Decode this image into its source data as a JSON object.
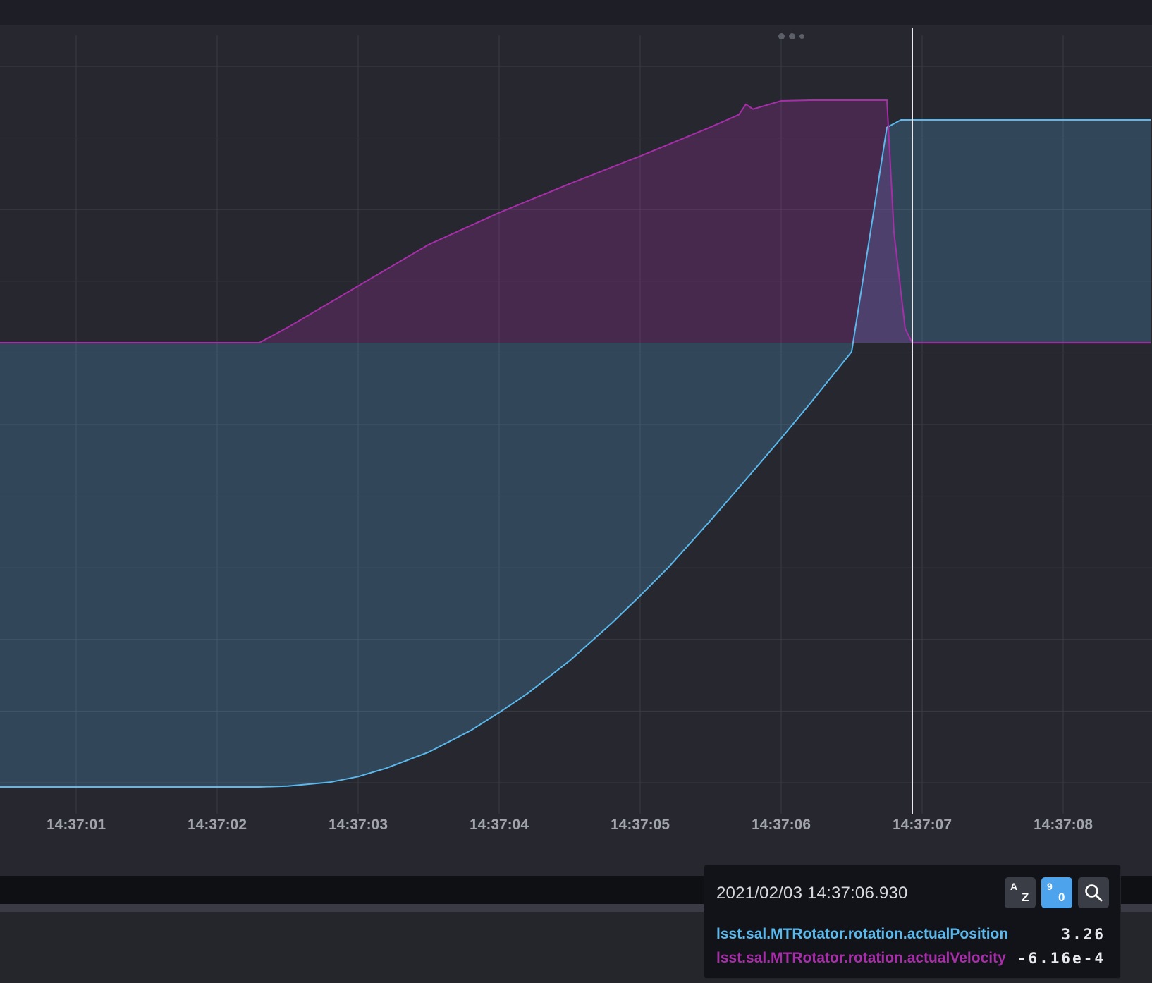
{
  "colors": {
    "position": "#5ab8ec",
    "velocity": "#a62ea8",
    "background": "#26272f",
    "grid": "#3a3c46",
    "cursor": "#e8e8ee"
  },
  "chart_data": {
    "type": "area",
    "xlabel": "",
    "ylabel": "",
    "grid": true,
    "x_ticks": [
      "14:37:01",
      "14:37:02",
      "14:37:03",
      "14:37:04",
      "14:37:05",
      "14:37:06",
      "14:37:07",
      "14:37:08"
    ],
    "x_range": [
      0.455,
      8.62
    ],
    "cursor_x": 6.93,
    "y_range": [
      -0.5,
      3.5
    ],
    "series": [
      {
        "name": "lsst.sal.MTRotator.rotation.actualPosition",
        "color": "#5ab8ec",
        "x": [
          0.455,
          1.0,
          1.5,
          2.0,
          2.3,
          2.5,
          2.8,
          3.0,
          3.2,
          3.5,
          3.8,
          4.0,
          4.2,
          4.5,
          4.8,
          5.0,
          5.2,
          5.5,
          5.8,
          6.0,
          6.2,
          6.5,
          6.75,
          6.85,
          8.62
        ],
        "values": [
          -3.82,
          -3.82,
          -3.82,
          -3.82,
          -3.82,
          -3.81,
          -3.77,
          -3.71,
          -3.62,
          -3.45,
          -3.22,
          -3.03,
          -2.83,
          -2.48,
          -2.08,
          -1.79,
          -1.49,
          -0.99,
          -0.47,
          -0.12,
          0.24,
          0.8,
          3.18,
          3.26,
          3.26
        ]
      },
      {
        "name": "lsst.sal.MTRotator.rotation.actualVelocity",
        "color": "#a62ea8",
        "x": [
          0.455,
          1.0,
          2.0,
          2.3,
          2.5,
          3.0,
          3.5,
          4.0,
          4.5,
          5.0,
          5.5,
          5.7,
          5.75,
          5.8,
          5.85,
          6.0,
          6.2,
          6.5,
          6.75,
          6.8,
          6.88,
          6.93,
          8.62
        ],
        "values": [
          0.0,
          0.0,
          0.0,
          0.0,
          0.22,
          0.82,
          1.42,
          1.88,
          2.3,
          2.7,
          3.12,
          3.3,
          3.45,
          3.38,
          3.41,
          3.5,
          3.51,
          3.51,
          3.51,
          1.6,
          0.2,
          -0.0006,
          -0.0006
        ]
      }
    ]
  },
  "tooltip": {
    "timestamp": "2021/02/03 14:37:06.930",
    "sort_alpha_top": "A",
    "sort_alpha_bottom": "Z",
    "sort_num_top": "9",
    "sort_num_bottom": "0",
    "rows": [
      {
        "name": "lsst.sal.MTRotator.rotation.actualPosition",
        "value": "3.26"
      },
      {
        "name": "lsst.sal.MTRotator.rotation.actualVelocity",
        "value": "-6.16e-4"
      }
    ]
  }
}
